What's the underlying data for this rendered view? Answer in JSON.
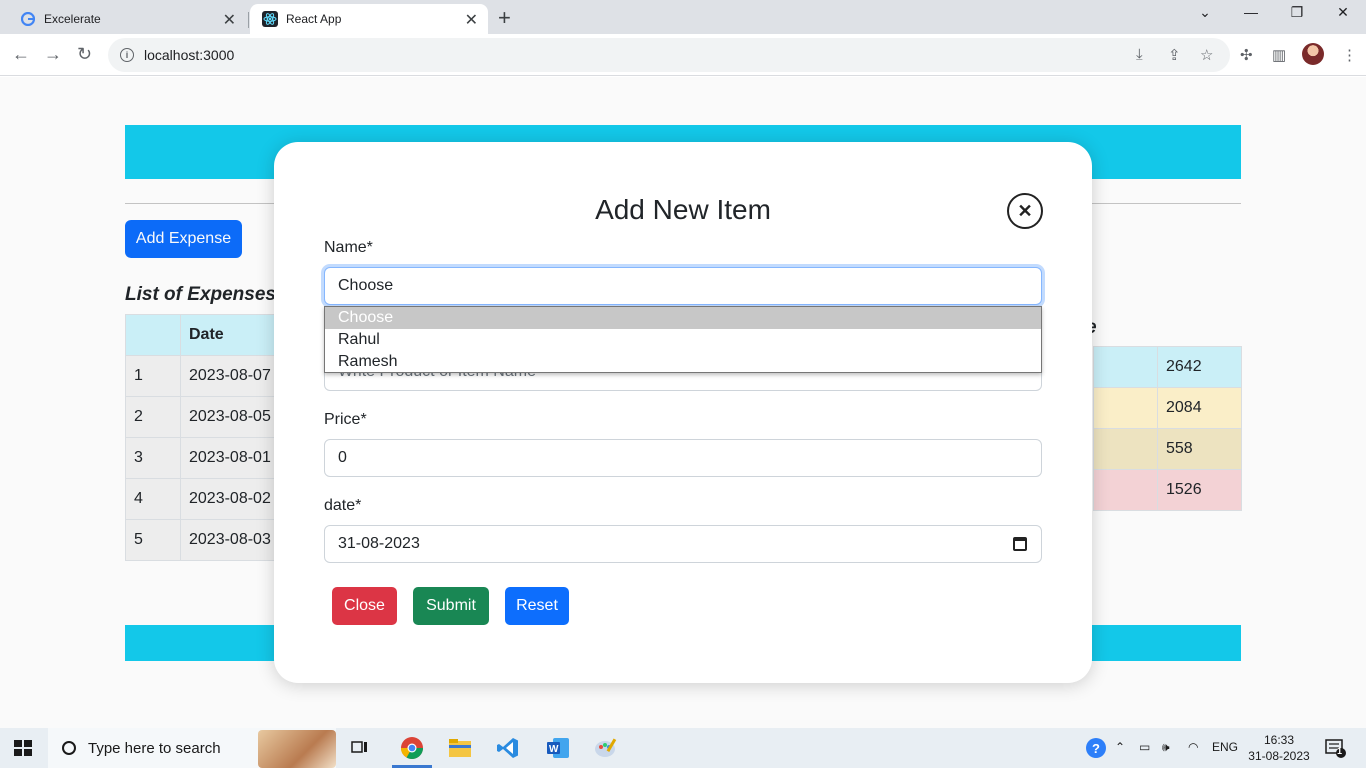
{
  "browser": {
    "tabs": [
      {
        "title": "Excelerate",
        "icon": "google-g-icon"
      },
      {
        "title": "React App",
        "icon": "react-icon",
        "active": true
      }
    ],
    "url": "localhost:3000"
  },
  "page": {
    "add_expense_label": "Add Expense",
    "list_title": "List of Expenses",
    "table_headers": [
      "",
      "Date"
    ],
    "rows": [
      {
        "no": "1",
        "date": "2023-08-07"
      },
      {
        "no": "2",
        "date": "2023-08-05"
      },
      {
        "no": "3",
        "date": "2023-08-01"
      },
      {
        "no": "4",
        "date": "2023-08-02"
      },
      {
        "no": "5",
        "date": "2023-08-03"
      }
    ],
    "right_title_fragment": "e",
    "right_values": [
      "2642",
      "2084",
      "558",
      "1526"
    ],
    "right_row_colors": [
      "#cff4fc",
      "#fff3cd",
      "#f2e8c4",
      "#f8d7da"
    ],
    "accent": "#14cdee"
  },
  "modal": {
    "title": "Add New Item",
    "name_label": "Name*",
    "name_value": "Choose",
    "name_options": [
      "Choose",
      "Rahul",
      "Ramesh"
    ],
    "product_placeholder": "Write Product or Item Name",
    "price_label": "Price*",
    "price_value": "0",
    "date_label": "date*",
    "date_value": "31-08-2023",
    "buttons": {
      "close": "Close",
      "submit": "Submit",
      "reset": "Reset"
    }
  },
  "taskbar": {
    "search_placeholder": "Type here to search",
    "lang": "ENG",
    "time": "16:33",
    "date": "31-08-2023",
    "notification_count": "1"
  }
}
